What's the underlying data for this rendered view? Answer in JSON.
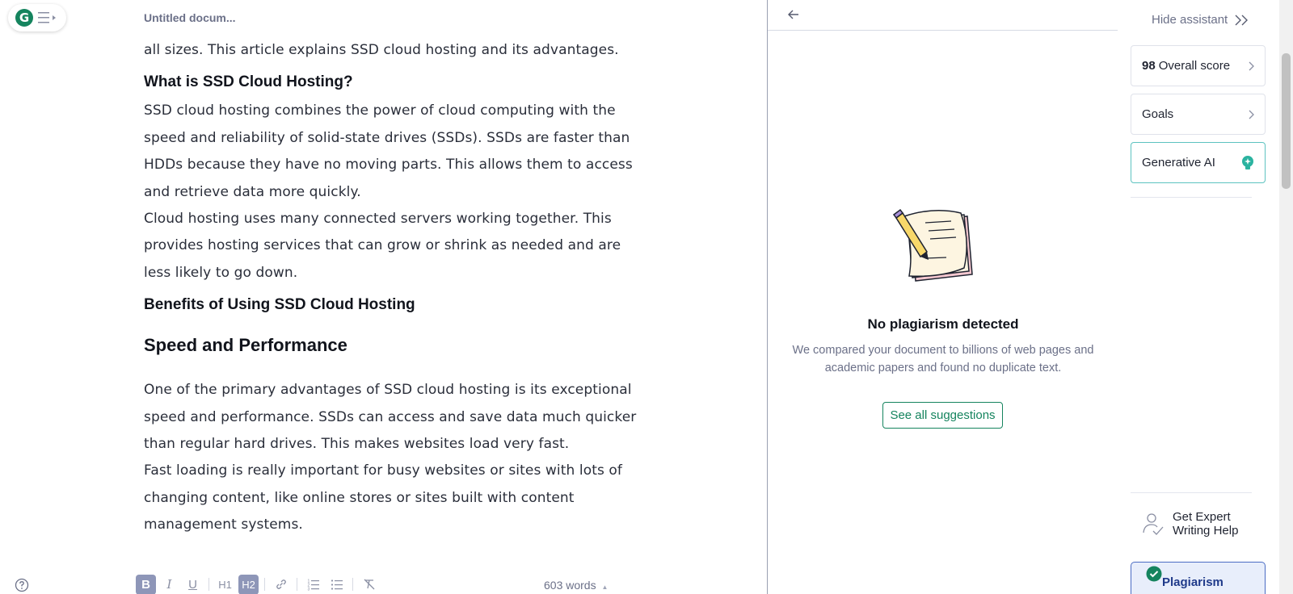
{
  "header": {
    "doc_title": "Untitled docum..."
  },
  "editor": {
    "p_intro": "all sizes. This article explains SSD cloud hosting and its advantages.",
    "h_what": "What is SSD Cloud Hosting?",
    "p_what_1": "SSD cloud hosting combines the power of cloud computing with the speed and reliability of solid-state drives (SSDs). SSDs are faster than HDDs because they have no moving parts. This allows them to access and retrieve data more quickly.",
    "p_what_2": "Cloud hosting uses many connected servers working together. This provides hosting services that can grow or shrink as needed and are less likely to go down.",
    "h_benefits": "Benefits of Using SSD Cloud Hosting",
    "h_speed": "Speed and Performance",
    "p_speed_1": "One of the primary advantages of SSD cloud hosting is its exceptional speed and performance. SSDs can access and save data much quicker than regular hard drives. This makes websites load very fast.",
    "p_speed_2": "Fast loading is really important for busy websites or sites with lots of changing content, like online stores or sites built with content management systems."
  },
  "toolbar": {
    "bold": "B",
    "italic": "I",
    "underline": "U",
    "h1": "H1",
    "h2": "H2",
    "word_count": "603 words"
  },
  "plagiarism_panel": {
    "title": "No plagiarism detected",
    "description": "We compared your document to billions of web pages and academic papers and found no duplicate text.",
    "see_all": "See all suggestions"
  },
  "sidebar": {
    "hide_assistant": "Hide assistant",
    "score_value": "98",
    "score_label": "Overall score",
    "goals": "Goals",
    "generative_ai": "Generative AI",
    "expert_line1": "Get Expert",
    "expert_line2": "Writing Help",
    "plagiarism": "Plagiarism"
  },
  "colors": {
    "brand_green": "#15845e",
    "ai_teal": "#2bb3a0",
    "plag_blue": "#1f3a8a"
  }
}
